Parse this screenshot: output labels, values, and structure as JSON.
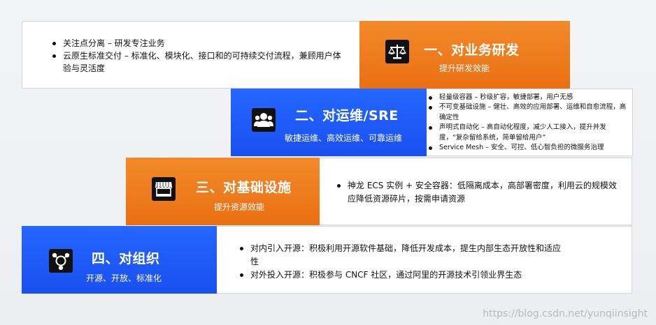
{
  "rows": [
    {
      "title": "一、对业务研发",
      "subtitle": "提升研发效能",
      "icon": "scale-icon",
      "color": "#ee7a1e",
      "bullets": [
        "关注点分离 – 研发专注业务",
        "云原生标准交付 – 标准化、模块化、接口和的可持续交付流程，兼顾用户体验与灵活度"
      ]
    },
    {
      "title": "二、对运维/SRE",
      "subtitle": "敏捷运维、高效运维、可靠运维",
      "icon": "team-icon",
      "color": "#1f5bf7",
      "bullets": [
        "轻量级容器 – 秒级扩容，敏捷部署，用户无感",
        "不可变基础设施 – 健壮、高效的应用部署、运维和自愈流程，高确定性",
        "声明式自动化 – 高自动化程度，减少人工接入，提升并发度，“复杂留给系统，简单留给用户”",
        "Service Mesh – 安全、可控、低心智负担的微服务治理"
      ]
    },
    {
      "title": "三、对基础设施",
      "subtitle": "提升资源效能",
      "icon": "store-icon",
      "color": "#ee7a1e",
      "bullets": [
        "神龙 ECS 实例 + 安全容器：低隔离成本，高部署密度，利用云的规模效应降低资源碎片，按需申请资源"
      ]
    },
    {
      "title": "四、对组织",
      "subtitle": "开源、开放、标准化",
      "icon": "network-icon",
      "color": "#1f5bf7",
      "bullets": [
        "对内引入开源：积极利用开源软件基础，降低开发成本，提生内部生态开放性和适应性",
        "对外投入开源：积极参与 CNCF 社区，通过阿里的开源技术引领业界生态"
      ]
    }
  ],
  "watermark": "https://blog.csdn.net/yunqiinsight"
}
